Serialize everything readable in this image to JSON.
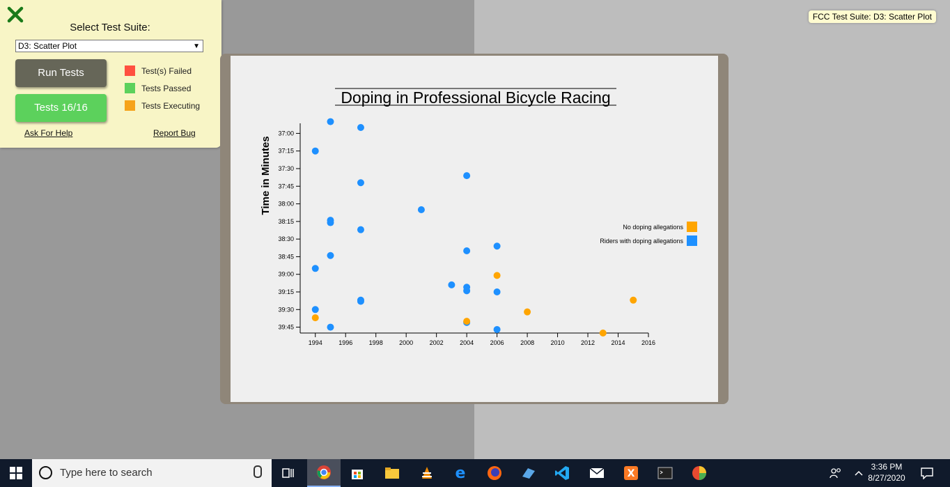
{
  "fcc_panel": {
    "select_label": "Select Test Suite:",
    "selected_suite": "D3: Scatter Plot",
    "run_button": "Run Tests",
    "tests_button": "Tests 16/16",
    "legend": [
      {
        "label": "Test(s) Failed",
        "color": "#ff5040"
      },
      {
        "label": "Tests Passed",
        "color": "#5cd15c"
      },
      {
        "label": "Tests Executing",
        "color": "#f6a31a"
      }
    ],
    "help_link": "Ask For Help",
    "bug_link": "Report Bug",
    "badge": "FCC Test Suite: D3: Scatter Plot"
  },
  "chart_data": {
    "type": "scatter",
    "title": "Doping in Professional Bicycle Racing",
    "ylabel": "Time in Minutes",
    "xlabel": "",
    "x_ticks": [
      "1994",
      "1996",
      "1998",
      "2000",
      "2002",
      "2004",
      "2006",
      "2008",
      "2010",
      "2012",
      "2014",
      "2016"
    ],
    "y_ticks": [
      "37:00",
      "37:15",
      "37:30",
      "37:45",
      "38:00",
      "38:15",
      "38:30",
      "38:45",
      "39:00",
      "39:15",
      "39:30",
      "39:45"
    ],
    "xlim": [
      1993,
      2016
    ],
    "ylim": [
      "36:55",
      "39:50"
    ],
    "legend": [
      {
        "label": "No doping allegations",
        "color": "#ffa500"
      },
      {
        "label": "Riders with doping allegations",
        "color": "#1e90ff"
      }
    ],
    "series": [
      {
        "name": "Riders with doping allegations",
        "color": "#1e90ff",
        "points": [
          {
            "x": 1995,
            "y": "36:50"
          },
          {
            "x": 1997,
            "y": "36:55"
          },
          {
            "x": 1994,
            "y": "37:15"
          },
          {
            "x": 2004,
            "y": "37:36"
          },
          {
            "x": 1997,
            "y": "37:42"
          },
          {
            "x": 2001,
            "y": "38:05"
          },
          {
            "x": 1995,
            "y": "38:14"
          },
          {
            "x": 1995,
            "y": "38:16"
          },
          {
            "x": 1997,
            "y": "38:22"
          },
          {
            "x": 2006,
            "y": "38:36"
          },
          {
            "x": 2004,
            "y": "38:40"
          },
          {
            "x": 1995,
            "y": "38:44"
          },
          {
            "x": 1994,
            "y": "38:55"
          },
          {
            "x": 2003,
            "y": "39:09"
          },
          {
            "x": 2004,
            "y": "39:11"
          },
          {
            "x": 2004,
            "y": "39:14"
          },
          {
            "x": 2006,
            "y": "39:15"
          },
          {
            "x": 1997,
            "y": "39:22"
          },
          {
            "x": 1997,
            "y": "39:23"
          },
          {
            "x": 1994,
            "y": "39:30"
          },
          {
            "x": 2004,
            "y": "39:41"
          },
          {
            "x": 1995,
            "y": "39:45"
          },
          {
            "x": 2006,
            "y": "39:47"
          }
        ]
      },
      {
        "name": "No doping allegations",
        "color": "#ffa500",
        "points": [
          {
            "x": 2006,
            "y": "39:01"
          },
          {
            "x": 2015,
            "y": "39:22"
          },
          {
            "x": 2008,
            "y": "39:32"
          },
          {
            "x": 1994,
            "y": "39:37"
          },
          {
            "x": 2004,
            "y": "39:40"
          },
          {
            "x": 2013,
            "y": "39:50"
          }
        ]
      }
    ]
  },
  "taskbar": {
    "search_placeholder": "Type here to search",
    "time": "3:36 PM",
    "date": "8/27/2020"
  }
}
